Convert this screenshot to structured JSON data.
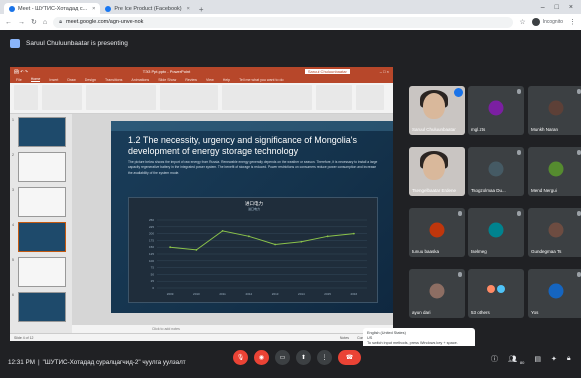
{
  "browser": {
    "tabs": [
      {
        "label": "Meet - ШУТИС-Хотадад с..."
      },
      {
        "label": "Pre Ice Product (Facebook)"
      }
    ],
    "new_tab_symbol": "+",
    "url": "meet.google.com/agn-unve-nok",
    "profile_label": "Incognito",
    "window_controls": [
      "–",
      "□",
      "×"
    ]
  },
  "presenter": {
    "text": "Saruul Chuluunbaatar is presenting"
  },
  "powerpoint": {
    "window_title": "ТЭЗ Ppt.pptx - PowerPoint",
    "account": "Saruul Chuluunbaatar",
    "ribbon_tabs": [
      "File",
      "Home",
      "Insert",
      "Draw",
      "Design",
      "Transitions",
      "Animations",
      "Slide Show",
      "Review",
      "View",
      "Help",
      "Tell me what you want to do"
    ],
    "status_left": "Slide 4 of 12",
    "status_notes": "Click to add notes",
    "status_right": [
      "Notes",
      "Comments",
      "63%"
    ],
    "thumb_numbers": [
      "1",
      "2",
      "3",
      "4",
      "5",
      "6",
      "7",
      "8"
    ],
    "slide": {
      "title": "1.2 The necessity, urgency and significance of Mongolia's development of energy storage technology",
      "body": "The picture below shows the import of raw energy from Russia. Renewable energy generally depends on the weather or season. Therefore, it is necessary to install a large capacity regenerative battery in the integrated power system. The benefit of storage is reduced. Power restrictions on consumers reduce power consumption and increase the availability of the system mode."
    }
  },
  "chart_data": {
    "type": "line",
    "title": "进口电力",
    "subtitle": "进口电力",
    "x": [
      "2009",
      "2010",
      "2011",
      "2012",
      "2013",
      "2014",
      "2015",
      "2016"
    ],
    "series": [
      {
        "values": [
          150,
          140,
          210,
          190,
          160,
          170,
          190,
          200
        ]
      }
    ],
    "ylim": [
      0,
      250
    ],
    "yticks": [
      "0",
      "25",
      "50",
      "75",
      "100",
      "125",
      "150",
      "175",
      "200",
      "225",
      "250"
    ],
    "color": "#8bc34a",
    "grid": true
  },
  "participants": [
    {
      "name": "Saruul Chuluunbaatar",
      "video": true,
      "speaking": true
    },
    {
      "name": "mgl.zts",
      "color": "#7b1fa2"
    },
    {
      "name": "Munkh Naran",
      "color": "#5d4037"
    },
    {
      "name": "Tsengelbaatar Erdene",
      "video": true
    },
    {
      "name": "Tsogzolmaa Du...",
      "color": "#455a64"
    },
    {
      "name": "Mend Nergui",
      "color": "#558b2f"
    },
    {
      "name": "tunuu baaska",
      "color": "#bf360c"
    },
    {
      "name": "tselmeg",
      "color": "#00838f"
    },
    {
      "name": "Gundegmaa Ts",
      "color": "#6d4c41"
    },
    {
      "name": "ayun dari",
      "color": "#8d6e63"
    },
    {
      "name": "53 others"
    },
    {
      "name": "Yos",
      "color": "#1565c0"
    }
  ],
  "popup": {
    "line1": "English (United States)",
    "line2": "US",
    "line3": "To switch input methods, press Windows key + space."
  },
  "meet": {
    "time": "12:31 PM",
    "separator": "|",
    "meeting_name": "\"ШУТИС-Хотадад суралцагчид-2\" чуулга уулзалт",
    "participant_count": "80"
  }
}
